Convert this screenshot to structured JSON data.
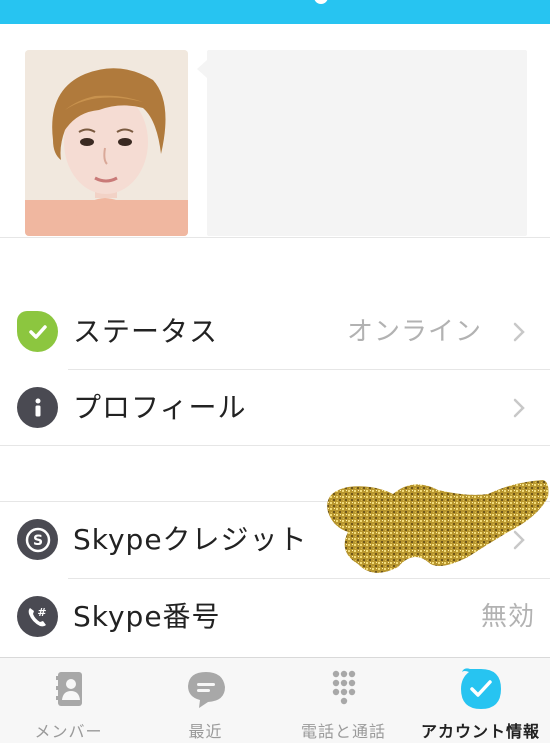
{
  "top_bar": {
    "color": "#27c4f1"
  },
  "profile": {
    "avatar_alt": "profile-photo",
    "mood_message": ""
  },
  "settings": {
    "group1": [
      {
        "icon": "status-online-icon",
        "label": "ステータス",
        "value": "オンライン",
        "has_chevron": true
      },
      {
        "icon": "info-icon",
        "label": "プロフィール",
        "value": "",
        "has_chevron": true
      }
    ],
    "group2": [
      {
        "icon": "skype-credit-icon",
        "label": "Skypeクレジット",
        "value": "",
        "has_chevron": true
      },
      {
        "icon": "skype-number-icon",
        "label": "Skype番号",
        "value": "無効",
        "has_chevron": false
      }
    ]
  },
  "tabbar": {
    "tabs": [
      {
        "label": "メンバー",
        "icon": "contacts-icon",
        "active": false
      },
      {
        "label": "最近",
        "icon": "chat-bubble-icon",
        "active": false
      },
      {
        "label": "電話と通話",
        "icon": "dialpad-icon",
        "active": false
      },
      {
        "label": "アカウント情報",
        "icon": "account-check-icon",
        "active": true
      }
    ]
  },
  "colors": {
    "accent": "#27c4f1",
    "status_green": "#8cc63f",
    "icon_dark": "#4a4a52",
    "value_gray": "#b2b2b2",
    "tab_inactive": "#9a9a9a"
  }
}
